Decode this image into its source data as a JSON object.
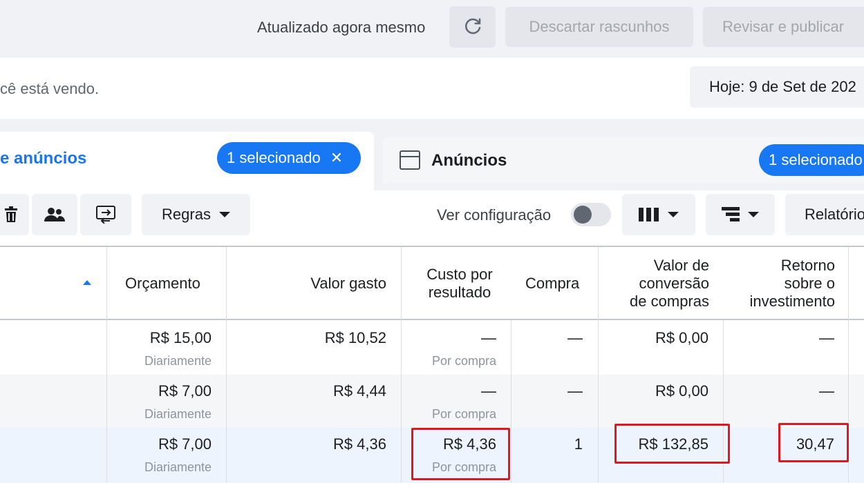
{
  "topbar": {
    "updated_text": "Atualizado agora mesmo",
    "discard_label": "Descartar rascunhos",
    "publish_label": "Revisar e publicar"
  },
  "infobar": {
    "viewing_text": "cê está vendo.",
    "date_label": "Hoje: 9 de Set de 202"
  },
  "tabs": {
    "adsets": {
      "label": "e anúncios",
      "selected": "1 selecionado"
    },
    "ads": {
      "label": "Anúncios",
      "selected": "1 selecionado"
    }
  },
  "toolbar": {
    "rules_label": "Regras",
    "view_config_label": "Ver configuração",
    "view_config_on": false,
    "reports_label": "Relatório"
  },
  "table": {
    "headers": {
      "budget": "Orçamento",
      "spent": "Valor gasto",
      "cpr_1": "Custo por",
      "cpr_2": "resultado",
      "purchases": "Compra",
      "conv_1": "Valor de",
      "conv_2": "conversão",
      "conv_3": "de compras",
      "roas_1": "Retorno",
      "roas_2": "sobre o",
      "roas_3": "investimento"
    },
    "rows": [
      {
        "budget": "R$ 15,00",
        "budget_sub": "Diariamente",
        "spent": "R$ 10,52",
        "cpr": "—",
        "cpr_sub": "Por compra",
        "purchases": "—",
        "conv_value": "R$ 0,00",
        "roas": "—"
      },
      {
        "budget": "R$ 7,00",
        "budget_sub": "Diariamente",
        "spent": "R$ 4,44",
        "cpr": "—",
        "cpr_sub": "Por compra",
        "purchases": "—",
        "conv_value": "R$ 0,00",
        "roas": "—"
      },
      {
        "budget": "R$ 7,00",
        "budget_sub": "Diariamente",
        "spent": "R$ 4,36",
        "cpr": "R$ 4,36",
        "cpr_sub": "Por compra",
        "purchases": "1",
        "conv_value": "R$ 132,85",
        "roas": "30,47"
      }
    ]
  },
  "colors": {
    "accent": "#1877f2",
    "highlight": "#e0171e"
  },
  "icons": [
    "refresh-icon",
    "close-icon",
    "ad-icon",
    "trash-icon",
    "people-icon",
    "swap-icon",
    "caret-down-icon",
    "columns-icon",
    "breakdown-icon",
    "sort-asc-icon"
  ]
}
